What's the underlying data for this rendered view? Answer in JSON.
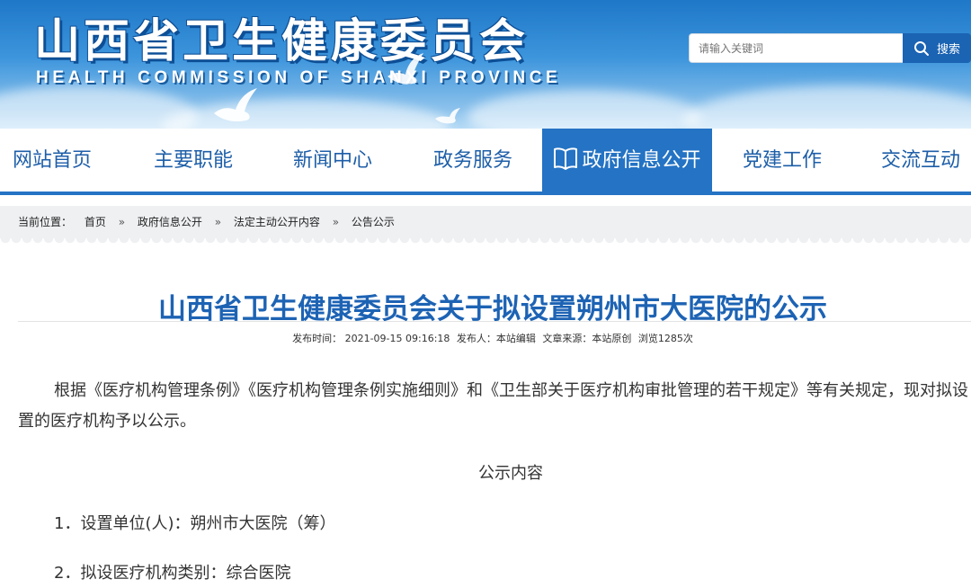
{
  "header": {
    "title": "山西省卫生健康委员会",
    "subtitle": "HEALTH COMMISSION OF SHANXI PROVINCE",
    "search_placeholder": "请输入关键词",
    "search_label": "搜索"
  },
  "nav": {
    "items": [
      {
        "label": "网站首页"
      },
      {
        "label": "主要职能"
      },
      {
        "label": "新闻中心"
      },
      {
        "label": "政务服务"
      },
      {
        "label": "政府信息公开"
      },
      {
        "label": "党建工作"
      },
      {
        "label": "交流互动"
      }
    ],
    "active_color": "#2473c4"
  },
  "breadcrumb": {
    "prefix": "当前位置：",
    "items": [
      "首页",
      "政府信息公开",
      "法定主动公开内容",
      "公告公示"
    ],
    "separator": "»"
  },
  "article": {
    "title": "山西省卫生健康委员会关于拟设置朔州市大医院的公示",
    "meta": {
      "published": "发布时间：  2021-09-15 09:16:18",
      "publisher": "发布人：本站编辑",
      "source": "文章来源：本站原创",
      "views": "浏览1285次"
    },
    "paragraph1": "根据《医疗机构管理条例》《医疗机构管理条例实施细则》和《卫生部关于医疗机构审批管理的若干规定》等有关规定，现对拟设置的医疗机构予以公示。",
    "section_heading": "公示内容",
    "items": [
      "1．设置单位(人)：朔州市大医院（筹）",
      "2．拟设医疗机构类别：综合医院"
    ]
  },
  "colors": {
    "brand_blue": "#1d63b4",
    "banner_top": "#1f78c8"
  }
}
